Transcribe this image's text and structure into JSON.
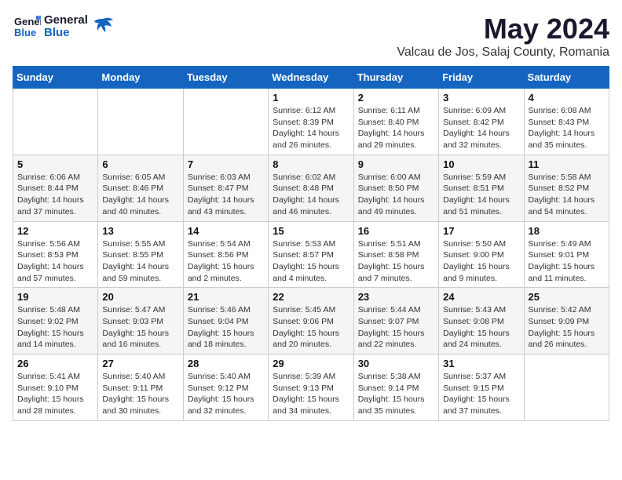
{
  "header": {
    "logo_general": "General",
    "logo_blue": "Blue",
    "month_title": "May 2024",
    "location": "Valcau de Jos, Salaj County, Romania"
  },
  "weekdays": [
    "Sunday",
    "Monday",
    "Tuesday",
    "Wednesday",
    "Thursday",
    "Friday",
    "Saturday"
  ],
  "weeks": [
    [
      {
        "day": "",
        "info": ""
      },
      {
        "day": "",
        "info": ""
      },
      {
        "day": "",
        "info": ""
      },
      {
        "day": "1",
        "info": "Sunrise: 6:12 AM\nSunset: 8:39 PM\nDaylight: 14 hours\nand 26 minutes."
      },
      {
        "day": "2",
        "info": "Sunrise: 6:11 AM\nSunset: 8:40 PM\nDaylight: 14 hours\nand 29 minutes."
      },
      {
        "day": "3",
        "info": "Sunrise: 6:09 AM\nSunset: 8:42 PM\nDaylight: 14 hours\nand 32 minutes."
      },
      {
        "day": "4",
        "info": "Sunrise: 6:08 AM\nSunset: 8:43 PM\nDaylight: 14 hours\nand 35 minutes."
      }
    ],
    [
      {
        "day": "5",
        "info": "Sunrise: 6:06 AM\nSunset: 8:44 PM\nDaylight: 14 hours\nand 37 minutes."
      },
      {
        "day": "6",
        "info": "Sunrise: 6:05 AM\nSunset: 8:46 PM\nDaylight: 14 hours\nand 40 minutes."
      },
      {
        "day": "7",
        "info": "Sunrise: 6:03 AM\nSunset: 8:47 PM\nDaylight: 14 hours\nand 43 minutes."
      },
      {
        "day": "8",
        "info": "Sunrise: 6:02 AM\nSunset: 8:48 PM\nDaylight: 14 hours\nand 46 minutes."
      },
      {
        "day": "9",
        "info": "Sunrise: 6:00 AM\nSunset: 8:50 PM\nDaylight: 14 hours\nand 49 minutes."
      },
      {
        "day": "10",
        "info": "Sunrise: 5:59 AM\nSunset: 8:51 PM\nDaylight: 14 hours\nand 51 minutes."
      },
      {
        "day": "11",
        "info": "Sunrise: 5:58 AM\nSunset: 8:52 PM\nDaylight: 14 hours\nand 54 minutes."
      }
    ],
    [
      {
        "day": "12",
        "info": "Sunrise: 5:56 AM\nSunset: 8:53 PM\nDaylight: 14 hours\nand 57 minutes."
      },
      {
        "day": "13",
        "info": "Sunrise: 5:55 AM\nSunset: 8:55 PM\nDaylight: 14 hours\nand 59 minutes."
      },
      {
        "day": "14",
        "info": "Sunrise: 5:54 AM\nSunset: 8:56 PM\nDaylight: 15 hours\nand 2 minutes."
      },
      {
        "day": "15",
        "info": "Sunrise: 5:53 AM\nSunset: 8:57 PM\nDaylight: 15 hours\nand 4 minutes."
      },
      {
        "day": "16",
        "info": "Sunrise: 5:51 AM\nSunset: 8:58 PM\nDaylight: 15 hours\nand 7 minutes."
      },
      {
        "day": "17",
        "info": "Sunrise: 5:50 AM\nSunset: 9:00 PM\nDaylight: 15 hours\nand 9 minutes."
      },
      {
        "day": "18",
        "info": "Sunrise: 5:49 AM\nSunset: 9:01 PM\nDaylight: 15 hours\nand 11 minutes."
      }
    ],
    [
      {
        "day": "19",
        "info": "Sunrise: 5:48 AM\nSunset: 9:02 PM\nDaylight: 15 hours\nand 14 minutes."
      },
      {
        "day": "20",
        "info": "Sunrise: 5:47 AM\nSunset: 9:03 PM\nDaylight: 15 hours\nand 16 minutes."
      },
      {
        "day": "21",
        "info": "Sunrise: 5:46 AM\nSunset: 9:04 PM\nDaylight: 15 hours\nand 18 minutes."
      },
      {
        "day": "22",
        "info": "Sunrise: 5:45 AM\nSunset: 9:06 PM\nDaylight: 15 hours\nand 20 minutes."
      },
      {
        "day": "23",
        "info": "Sunrise: 5:44 AM\nSunset: 9:07 PM\nDaylight: 15 hours\nand 22 minutes."
      },
      {
        "day": "24",
        "info": "Sunrise: 5:43 AM\nSunset: 9:08 PM\nDaylight: 15 hours\nand 24 minutes."
      },
      {
        "day": "25",
        "info": "Sunrise: 5:42 AM\nSunset: 9:09 PM\nDaylight: 15 hours\nand 26 minutes."
      }
    ],
    [
      {
        "day": "26",
        "info": "Sunrise: 5:41 AM\nSunset: 9:10 PM\nDaylight: 15 hours\nand 28 minutes."
      },
      {
        "day": "27",
        "info": "Sunrise: 5:40 AM\nSunset: 9:11 PM\nDaylight: 15 hours\nand 30 minutes."
      },
      {
        "day": "28",
        "info": "Sunrise: 5:40 AM\nSunset: 9:12 PM\nDaylight: 15 hours\nand 32 minutes."
      },
      {
        "day": "29",
        "info": "Sunrise: 5:39 AM\nSunset: 9:13 PM\nDaylight: 15 hours\nand 34 minutes."
      },
      {
        "day": "30",
        "info": "Sunrise: 5:38 AM\nSunset: 9:14 PM\nDaylight: 15 hours\nand 35 minutes."
      },
      {
        "day": "31",
        "info": "Sunrise: 5:37 AM\nSunset: 9:15 PM\nDaylight: 15 hours\nand 37 minutes."
      },
      {
        "day": "",
        "info": ""
      }
    ]
  ]
}
